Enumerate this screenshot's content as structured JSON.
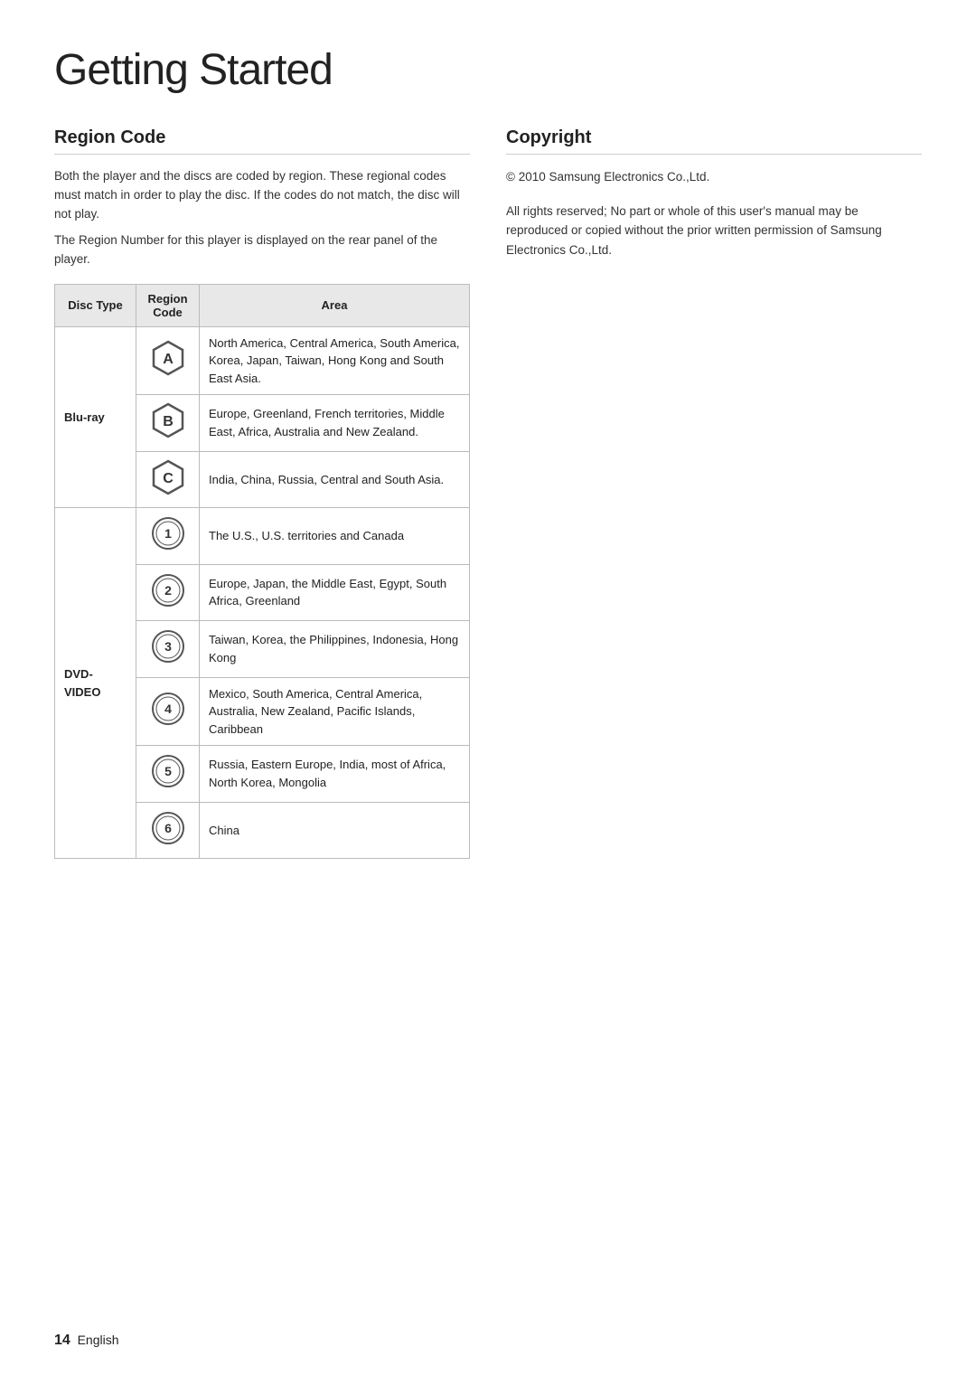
{
  "page": {
    "title": "Getting Started",
    "page_number": "14",
    "page_label": "English"
  },
  "region_code": {
    "section_title": "Region Code",
    "paragraphs": [
      "Both the player and the discs are coded by region. These regional codes must match in order to play the disc. If the codes do not match, the disc will not play.",
      "The Region Number for this player is displayed on the rear panel of the player."
    ],
    "table": {
      "headers": [
        "Disc Type",
        "Region Code",
        "Area"
      ],
      "rows": [
        {
          "disc_type": "Blu-ray",
          "icon": "A",
          "icon_type": "hexagon",
          "area": "North America, Central America, South America, Korea, Japan, Taiwan, Hong Kong and South East Asia.",
          "rowspan": 3
        },
        {
          "disc_type": "",
          "icon": "B",
          "icon_type": "hexagon",
          "area": "Europe, Greenland, French territories, Middle East, Africa, Australia and New Zealand."
        },
        {
          "disc_type": "",
          "icon": "C",
          "icon_type": "hexagon",
          "area": "India, China, Russia, Central and South Asia."
        },
        {
          "disc_type": "DVD-VIDEO",
          "icon": "1",
          "icon_type": "circle",
          "area": "The U.S., U.S. territories and Canada",
          "rowspan": 6
        },
        {
          "disc_type": "",
          "icon": "2",
          "icon_type": "circle",
          "area": "Europe, Japan, the Middle East, Egypt, South Africa, Greenland"
        },
        {
          "disc_type": "",
          "icon": "3",
          "icon_type": "circle",
          "area": "Taiwan, Korea, the Philippines, Indonesia, Hong Kong"
        },
        {
          "disc_type": "",
          "icon": "4",
          "icon_type": "circle",
          "area": "Mexico, South America, Central America, Australia, New Zealand, Pacific Islands, Caribbean"
        },
        {
          "disc_type": "",
          "icon": "5",
          "icon_type": "circle",
          "area": "Russia, Eastern Europe, India, most of Africa, North Korea, Mongolia"
        },
        {
          "disc_type": "",
          "icon": "6",
          "icon_type": "circle",
          "area": "China"
        }
      ]
    }
  },
  "copyright": {
    "section_title": "Copyright",
    "lines": [
      "© 2010 Samsung Electronics Co.,Ltd.",
      "All rights reserved; No part or whole of this user's manual may be reproduced or copied without the prior written permission of Samsung Electronics Co.,Ltd."
    ]
  }
}
